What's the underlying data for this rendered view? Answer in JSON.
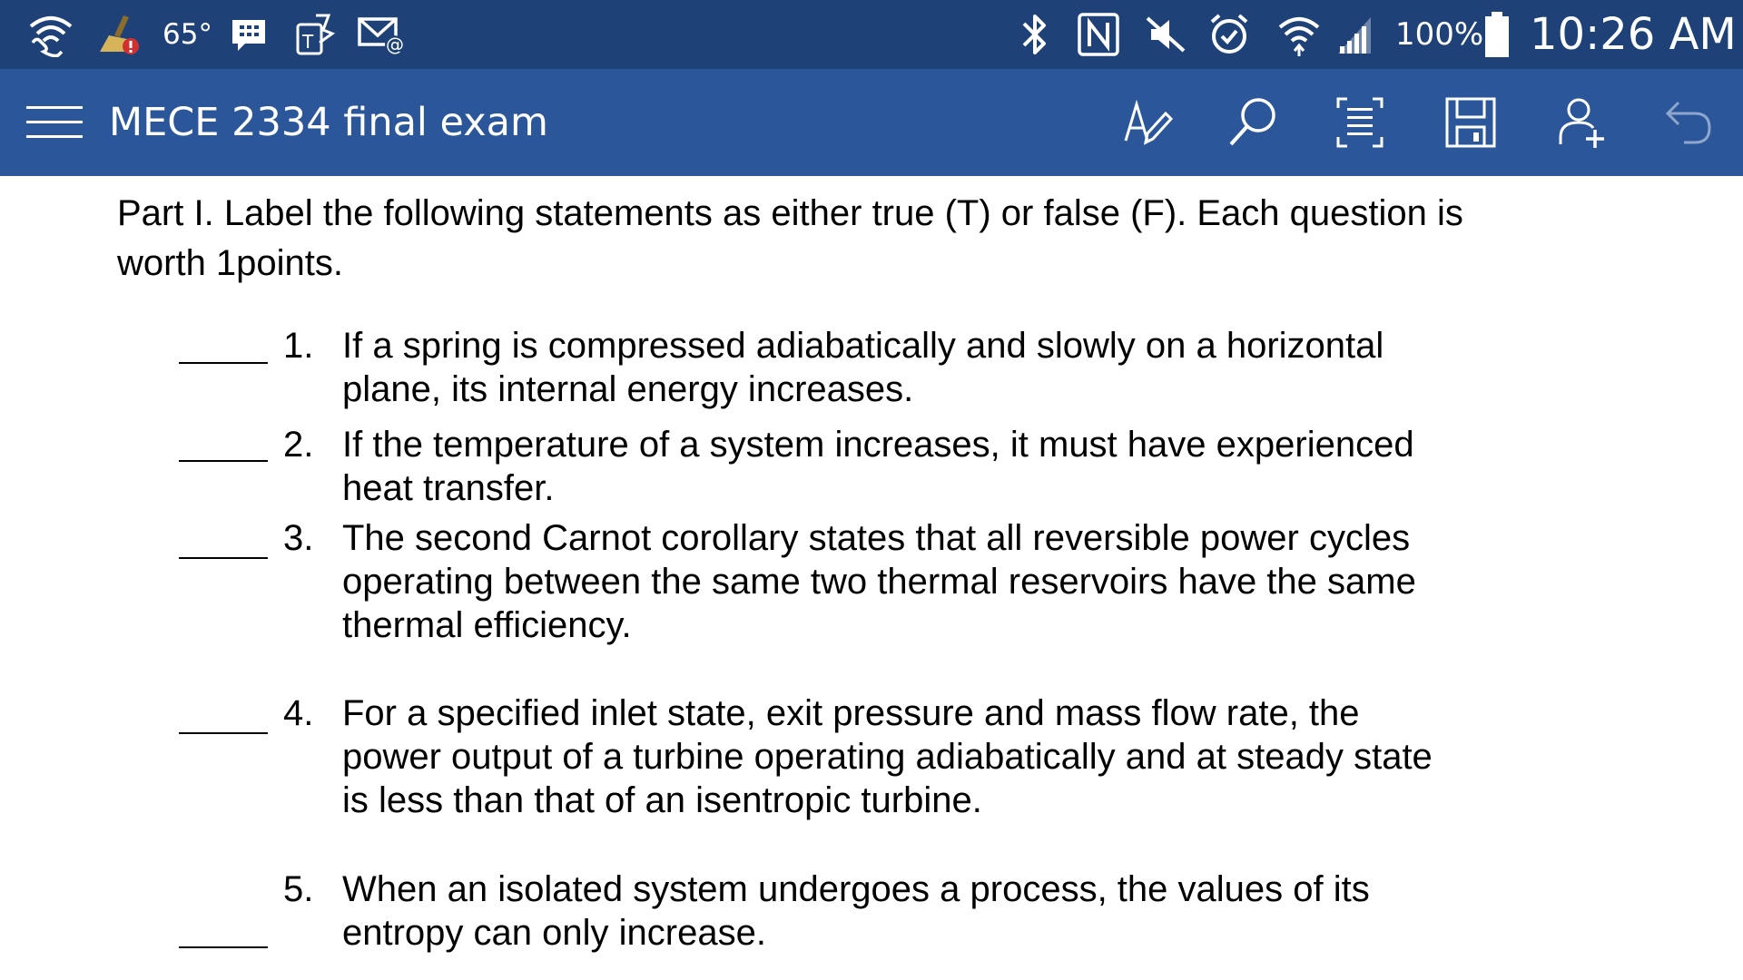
{
  "status_bar": {
    "temperature": "65°",
    "battery": "100%",
    "time": "10:26 AM",
    "icons": [
      "wifi-calling-icon",
      "cleaner-alert-icon",
      "messenger-icon",
      "touch-tool-icon",
      "email-icon",
      "bluetooth-icon",
      "nfc-icon",
      "mute-icon",
      "alarm-icon",
      "wifi-icon",
      "signal-icon",
      "battery-icon"
    ]
  },
  "app_bar": {
    "title": "MECE 2334 final exam",
    "actions": [
      "menu-icon",
      "edit-icon",
      "search-icon",
      "reading-view-icon",
      "save-icon",
      "share-icon",
      "undo-icon"
    ]
  },
  "document": {
    "intro_line1": "Part I. Label the following statements as either true (T) or false (F). Each question is",
    "intro_line2": "worth 1points.",
    "questions": [
      {
        "number": "1.",
        "line1": "If a spring is compressed adiabatically and slowly on a horizontal",
        "line2": "plane, its internal energy increases."
      },
      {
        "number": "2.",
        "line1": "If the temperature of a system increases, it must have experienced",
        "line2": "heat transfer."
      },
      {
        "number": "3.",
        "line1": "The second Carnot corollary states that all reversible power cycles",
        "line2": "operating between the same two thermal reservoirs have the same",
        "line3": "thermal efficiency."
      },
      {
        "number": "4.",
        "line1": "For a specified inlet state, exit pressure and mass flow rate, the",
        "line2": "power output of a turbine operating adiabatically and at steady state",
        "line3": "is less than that of an isentropic turbine."
      },
      {
        "number": "5.",
        "line1": "When an isolated system undergoes a process, the values of its",
        "line2": "entropy can only increase."
      }
    ]
  }
}
